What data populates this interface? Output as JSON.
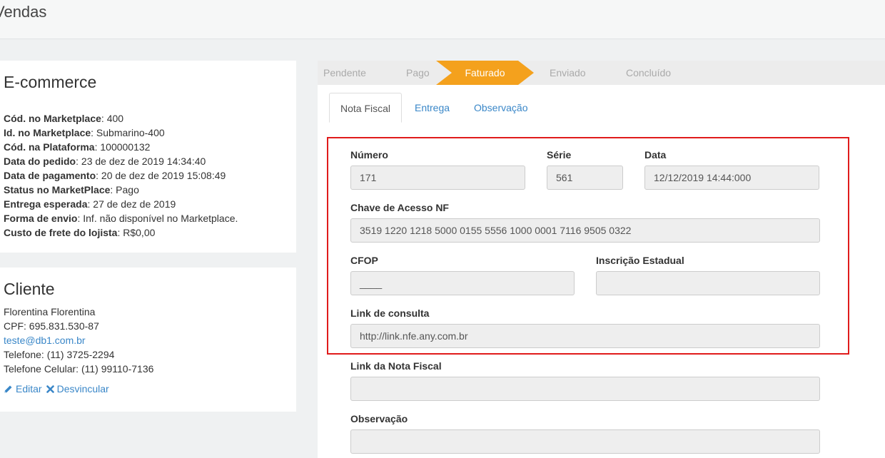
{
  "header": {
    "title": "Vendas"
  },
  "ecommerce": {
    "title": "E-commerce",
    "rows": [
      {
        "label": "Cód. no Marketplace",
        "value": ": 400"
      },
      {
        "label": "Id. no Marketplace",
        "value": ": Submarino-400"
      },
      {
        "label": "Cód. na Plataforma",
        "value": ": 100000132"
      },
      {
        "label": "Data do pedido",
        "value": ": 23 de dez de 2019 14:34:40"
      },
      {
        "label": "Data de pagamento",
        "value": ": 20 de dez de 2019 15:08:49"
      },
      {
        "label": "Status no MarketPlace",
        "value": ": Pago"
      },
      {
        "label": "Entrega esperada",
        "value": ": 27 de dez de 2019"
      },
      {
        "label": "Forma de envio",
        "value": ": Inf. não disponível no Marketplace."
      },
      {
        "label": "Custo de frete do lojista",
        "value": ": R$0,00"
      }
    ]
  },
  "cliente": {
    "title": "Cliente",
    "name": "Florentina Florentina",
    "cpf": "CPF: 695.831.530-87",
    "email": "teste@db1.com.br",
    "phone": "Telefone: (11) 3725-2294",
    "mobile": "Telefone Celular: (11) 99110-7136",
    "edit_label": "Editar",
    "unlink_label": "Desvincular"
  },
  "steps": [
    "Pendente",
    "Pago",
    "Faturado",
    "Enviado",
    "Concluído"
  ],
  "active_step_color": "#f4a11d",
  "tabs": [
    "Nota Fiscal",
    "Entrega",
    "Observação"
  ],
  "form": {
    "numero_label": "Número",
    "numero": "171",
    "serie_label": "Série",
    "serie": "561",
    "data_label": "Data",
    "data": "12/12/2019 14:44:000",
    "chave_label": "Chave de Acesso NF",
    "chave": "3519 1220 1218 5000 0155 5556 1000 0001 7116 9505 0322",
    "cfop_label": "CFOP",
    "cfop": "____",
    "ie_label": "Inscrição Estadual",
    "ie": "",
    "link_consulta_label": "Link de consulta",
    "link_consulta": "http://link.nfe.any.com.br",
    "link_nf_label": "Link da Nota Fiscal",
    "link_nf": "",
    "obs_label": "Observação",
    "obs": ""
  }
}
